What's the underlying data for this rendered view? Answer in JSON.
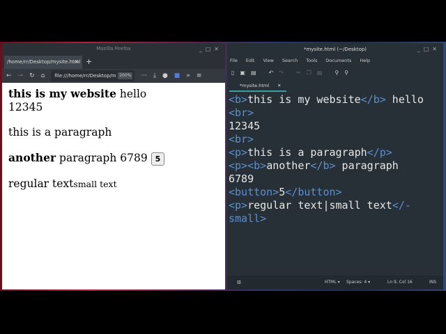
{
  "firefox": {
    "title": "Mozilla Firefox",
    "tab": "/home/rr/Desktop/mysite.html",
    "url": "file:///home/rr/Desktop/m",
    "zoom": "200%",
    "page": {
      "bold1": "this is my website",
      "hello": " hello",
      "num": "12345",
      "p1": "this is a paragraph",
      "bold2": "another",
      "p2": " paragraph 6789 ",
      "button": "5",
      "regular": "regular text",
      "small": "small text"
    }
  },
  "editor": {
    "title": "*mysite.html (~/Desktop)",
    "menu": [
      "File",
      "Edit",
      "View",
      "Search",
      "Tools",
      "Documents",
      "Help"
    ],
    "tab": "*mysite.html",
    "lines": [
      [
        [
          "t",
          "<b>"
        ],
        [
          "x",
          "this is my website"
        ],
        [
          "t",
          "</b>"
        ],
        [
          "x",
          " hello"
        ]
      ],
      [
        [
          "t",
          "<br>"
        ]
      ],
      [
        [
          "x",
          "12345"
        ]
      ],
      [
        [
          "t",
          "<br>"
        ]
      ],
      [
        [
          "t",
          "<p>"
        ],
        [
          "x",
          "this is a paragraph"
        ],
        [
          "t",
          "</p>"
        ]
      ],
      [
        [
          "t",
          "<p><b>"
        ],
        [
          "x",
          "another"
        ],
        [
          "t",
          "</b>"
        ],
        [
          "x",
          " paragraph"
        ]
      ],
      [
        [
          "x",
          "6789"
        ]
      ],
      [
        [
          "t",
          "<button>"
        ],
        [
          "x",
          "5"
        ],
        [
          "t",
          "</button>"
        ]
      ],
      [
        [
          "t",
          "<p>"
        ],
        [
          "x",
          "regular text|small text"
        ],
        [
          "t",
          "</-"
        ]
      ],
      [
        [
          "t",
          "small>"
        ]
      ]
    ],
    "status": {
      "lang": "HTML ▾",
      "spaces": "Spaces: 4 ▾",
      "pos": "Ln 9, Col 16",
      "mode": "INS"
    }
  }
}
